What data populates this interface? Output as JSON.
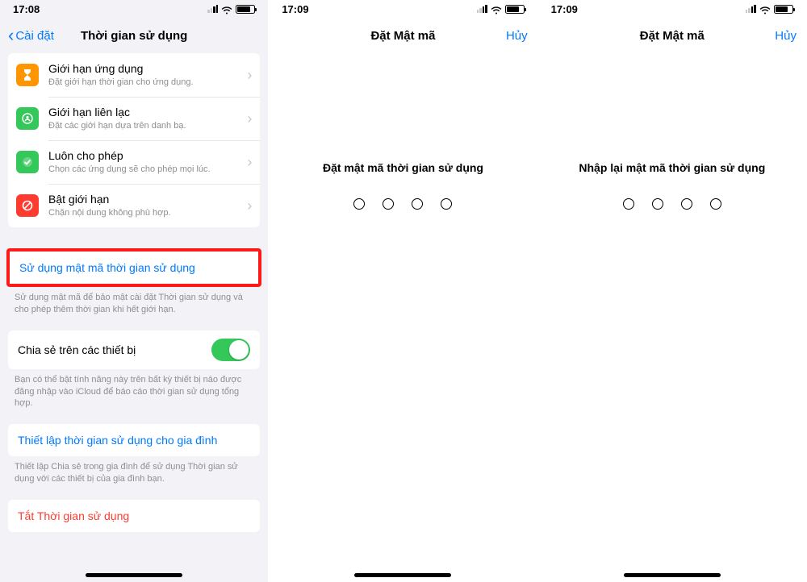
{
  "p1": {
    "time": "17:08",
    "back_label": "Cài đặt",
    "title": "Thời gian sử dụng",
    "rows": {
      "app_limits": {
        "title": "Giới hạn ứng dụng",
        "sub": "Đặt giới hạn thời gian cho ứng dụng."
      },
      "comm_limits": {
        "title": "Giới hạn liên lạc",
        "sub": "Đặt các giới hạn dựa trên danh bạ."
      },
      "always_allowed": {
        "title": "Luôn cho phép",
        "sub": "Chọn các ứng dụng sẽ cho phép mọi lúc."
      },
      "content": {
        "title": "Bật giới hạn",
        "sub": "Chặn nội dung không phù hợp."
      }
    },
    "use_passcode": "Sử dụng mật mã thời gian sử dụng",
    "passcode_footer": "Sử dụng mật mã để bảo mật cài đặt Thời gian sử dụng và cho phép thêm thời gian khi hết giới hạn.",
    "share_label": "Chia sẻ trên các thiết bị",
    "share_footer": "Bạn có thể bật tính năng này trên bất kỳ thiết bị nào được đăng nhập vào iCloud để báo cáo thời gian sử dụng tổng hợp.",
    "family_setup": "Thiết lập thời gian sử dụng cho gia đình",
    "family_footer": "Thiết lập Chia sẻ trong gia đình để sử dụng Thời gian sử dụng với các thiết bị của gia đình bạn.",
    "turn_off": "Tắt Thời gian sử dụng"
  },
  "p2": {
    "time": "17:09",
    "title": "Đặt Mật mã",
    "cancel": "Hủy",
    "prompt": "Đặt mật mã thời gian sử dụng"
  },
  "p3": {
    "time": "17:09",
    "title": "Đặt Mật mã",
    "cancel": "Hủy",
    "prompt": "Nhập lại mật mã thời gian sử dụng"
  }
}
